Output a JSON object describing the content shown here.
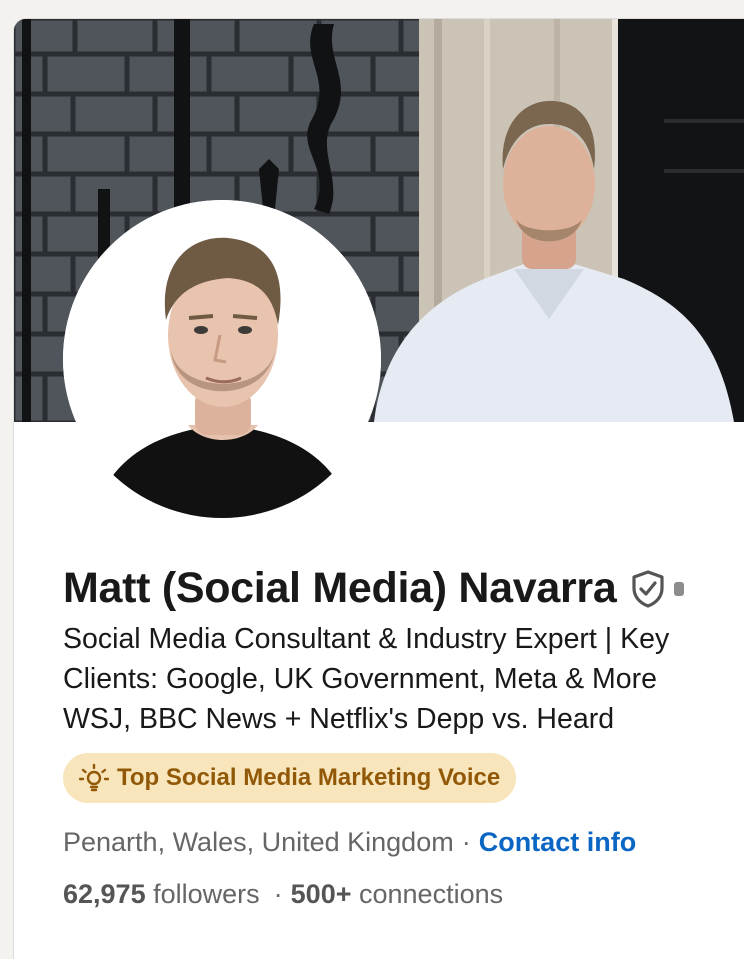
{
  "profile": {
    "name": "Matt (Social Media) Navarra",
    "headline_lines": [
      "Social Media Consultant & Industry Expert | Key",
      "Clients: Google, UK Government, Meta & More",
      "WSJ, BBC News + Netflix's Depp vs. Heard"
    ],
    "voice_badge": "Top Social Media Marketing Voice",
    "location": "Penarth, Wales, United Kingdom",
    "separator": "·",
    "contact_link": "Contact info",
    "followers_count": "62,975",
    "followers_label": "followers",
    "connections_count": "500+",
    "connections_label": "connections"
  },
  "icons": {
    "verified": "shield-check-icon",
    "voice": "lightbulb-icon"
  },
  "colors": {
    "link": "#0a66c2",
    "badge_bg": "#f8e5bc",
    "badge_text": "#915907",
    "text_primary": "#191919",
    "text_secondary": "#666666"
  }
}
